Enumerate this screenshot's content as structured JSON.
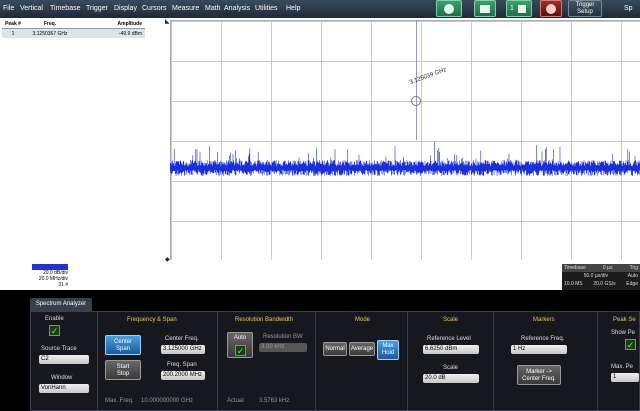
{
  "menu": [
    "File",
    "Vertical",
    "Timebase",
    "Trigger",
    "Display",
    "Cursors",
    "Measure",
    "Math",
    "Analysis",
    "Utilities",
    "Help"
  ],
  "toolbar": {
    "trigger_setup": "Trigger\nSetup",
    "sp_label": "Sp",
    "badge_one": "1"
  },
  "peak_table": {
    "headers": [
      "Peak #",
      "Freq.",
      "Amplitude"
    ],
    "rows": [
      {
        "n": "1",
        "freq": "3.1250367 GHz",
        "amp": "-49.9 dBm"
      }
    ]
  },
  "marker_label": "3.125039 GHz",
  "channel_box": {
    "line1": "20.0 dB/div",
    "line2": "20.0 MHz/div",
    "line3": "31 #"
  },
  "timebase": {
    "headers": [
      "Timebase",
      "0 µs",
      "Trig"
    ],
    "rows": [
      [
        "",
        "50.0 µs/div",
        "Auto"
      ],
      [
        "10.0 MS",
        "20.0 GS/s",
        "Edge"
      ]
    ]
  },
  "dialog": {
    "tab": "Spectrum Analyzer",
    "enable_label": "Enable",
    "source_trace_label": "Source Trace",
    "source_trace_value": "C2",
    "window_label": "Window",
    "window_value": "VonHann",
    "freq_span_title": "Frequency & Span",
    "center_span_btn": "Center\nSpan",
    "start_stop_btn": "Start\nStop",
    "center_freq_label": "Center Freq.",
    "center_freq_value": "3.125000 GHz",
    "freq_span_label": "Freq. Span",
    "freq_span_value": "200.2000 MHz",
    "max_freq_label": "Max. Freq.",
    "max_freq_value": "10.000000000 GHz",
    "rbw_title": "Resolution Bandwidth",
    "auto_label": "Auto",
    "rbw_label": "Resolution BW",
    "rbw_value": "3.00 kHz",
    "actual_label": "Actual",
    "actual_value": "3.5763 kHz",
    "mode_title": "Mode",
    "mode_normal": "Normal",
    "mode_average": "Average",
    "mode_maxhold": "Max\nHold",
    "scale_title": "Scale",
    "ref_level_label": "Reference Level",
    "ref_level_value": "6.6250 dBm",
    "scale_label": "Scale",
    "scale_value": "20.0 dB",
    "markers_title": "Markers",
    "ref_freq_label": "Reference Freq.",
    "ref_freq_value": "1 Hz",
    "marker_center_btn": "Marker ->\nCenter Freq.",
    "peak_title": "Peak Se",
    "show_peaks_label": "Show Pe",
    "max_peaks_label": "Max. Pe",
    "max_peaks_value": "1"
  }
}
